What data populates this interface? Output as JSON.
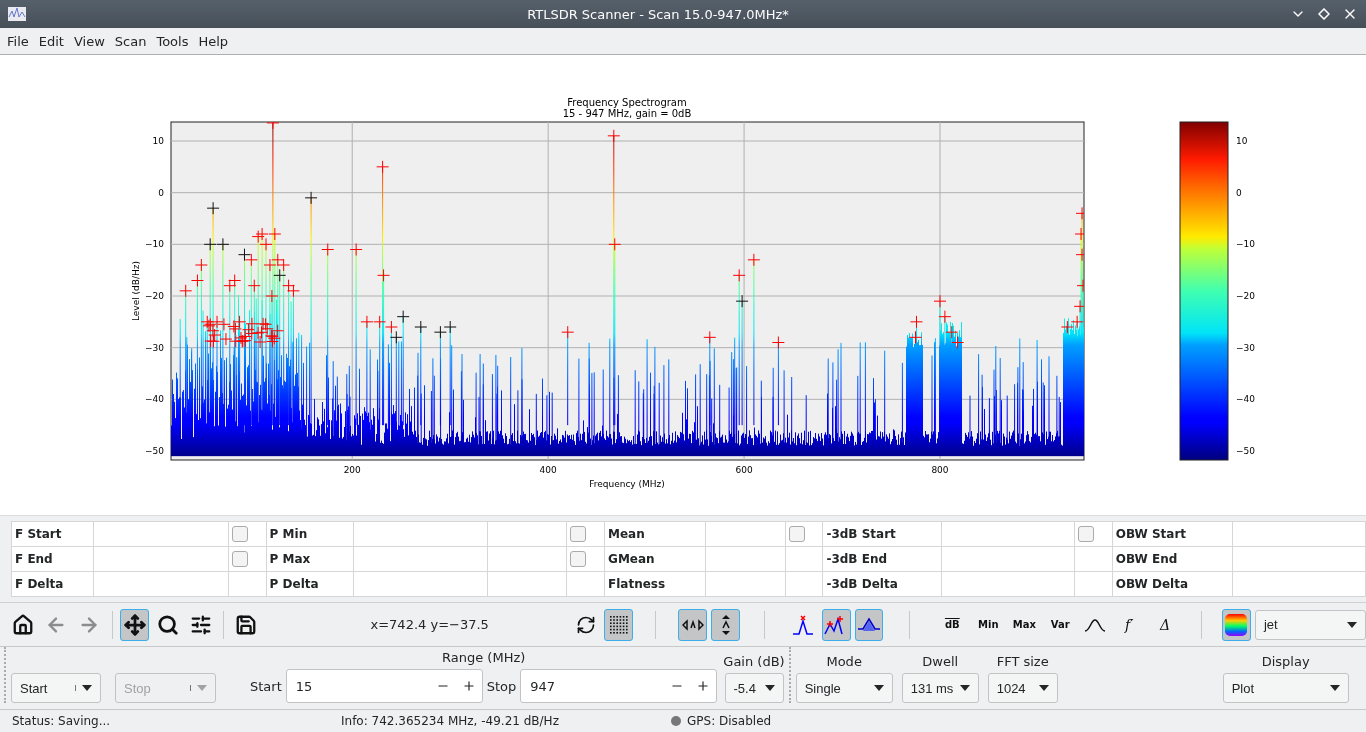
{
  "window": {
    "title": "RTLSDR Scanner - Scan 15.0-947.0MHz*"
  },
  "menu": [
    "File",
    "Edit",
    "View",
    "Scan",
    "Tools",
    "Help"
  ],
  "plot": {
    "title": "Frequency Spectrogram",
    "subtitle": "15 - 947 MHz, gain = 0dB",
    "xlabel": "Frequency (MHz)",
    "ylabel": "Level (dB/Hz)",
    "xticks": [
      "200",
      "400",
      "600",
      "800"
    ],
    "yticks": [
      "10",
      "0",
      "−10",
      "−20",
      "−30",
      "−40",
      "−50"
    ],
    "colorbar_ticks": [
      "10",
      "0",
      "−10",
      "−20",
      "−30",
      "−40",
      "−50"
    ]
  },
  "measurements": [
    [
      {
        "label": "F Start"
      },
      {
        "label": "P Min",
        "checked": false
      },
      {
        "label": "Mean",
        "checked": false
      },
      {
        "label": "-3dB Start",
        "checked": false
      },
      {
        "label": "OBW Start",
        "checked": false
      }
    ],
    [
      {
        "label": "F End"
      },
      {
        "label": "P Max",
        "checked": false
      },
      {
        "label": "GMean",
        "checked": false
      },
      {
        "label": "-3dB End"
      },
      {
        "label": "OBW End"
      }
    ],
    [
      {
        "label": "F Delta"
      },
      {
        "label": "P Delta"
      },
      {
        "label": "Flatness"
      },
      {
        "label": "-3dB Delta"
      },
      {
        "label": "OBW Delta"
      }
    ]
  ],
  "toolbar": {
    "navigation": [
      {
        "kind": "home",
        "disabled": false
      },
      {
        "kind": "back",
        "disabled": true
      },
      {
        "kind": "forward",
        "disabled": true
      },
      {
        "kind": "pan",
        "selected": true
      },
      {
        "kind": "zoom",
        "selected": false
      },
      {
        "kind": "configure",
        "selected": false
      },
      {
        "kind": "save",
        "selected": false
      }
    ],
    "coordinates": "x=742.4 y=−37.5",
    "view_tools": [
      {
        "kind": "refresh",
        "selected": false
      },
      {
        "kind": "grid",
        "selected": true
      },
      {
        "kind": "fit-x",
        "selected": true
      },
      {
        "kind": "fit-y",
        "selected": true
      },
      {
        "kind": "peak",
        "selected": false
      },
      {
        "kind": "peaks",
        "selected": true
      },
      {
        "kind": "fill",
        "selected": true
      }
    ],
    "measure_tools": [
      {
        "kind": "overline",
        "label": "dB"
      },
      {
        "kind": "text",
        "label": "Min"
      },
      {
        "kind": "text",
        "label": "Max"
      },
      {
        "kind": "text",
        "label": "Var"
      },
      {
        "kind": "bell"
      },
      {
        "kind": "math",
        "label": "f′"
      },
      {
        "kind": "math",
        "label": "Δ"
      }
    ],
    "colormap_button": {
      "selected": true
    },
    "colormap": "jet"
  },
  "controls": {
    "start_combo": {
      "value": "Start",
      "disabled": false
    },
    "stop_combo": {
      "value": "Stop",
      "disabled": true
    },
    "range": {
      "title": "Range (MHz)",
      "start_label": "Start",
      "start": "15",
      "stop_label": "Stop",
      "stop": "947"
    },
    "gain": {
      "title": "Gain (dB)",
      "value": "-5.4"
    },
    "mode": {
      "title": "Mode",
      "value": "Single"
    },
    "dwell": {
      "title": "Dwell",
      "value": "131 ms"
    },
    "fft": {
      "title": "FFT size",
      "value": "1024"
    },
    "display": {
      "title": "Display",
      "value": "Plot"
    }
  },
  "status": {
    "text": "Status: Saving...",
    "info": "Info: 742.365234 MHz, -49.21 dB/Hz",
    "gps": "GPS: Disabled"
  }
}
